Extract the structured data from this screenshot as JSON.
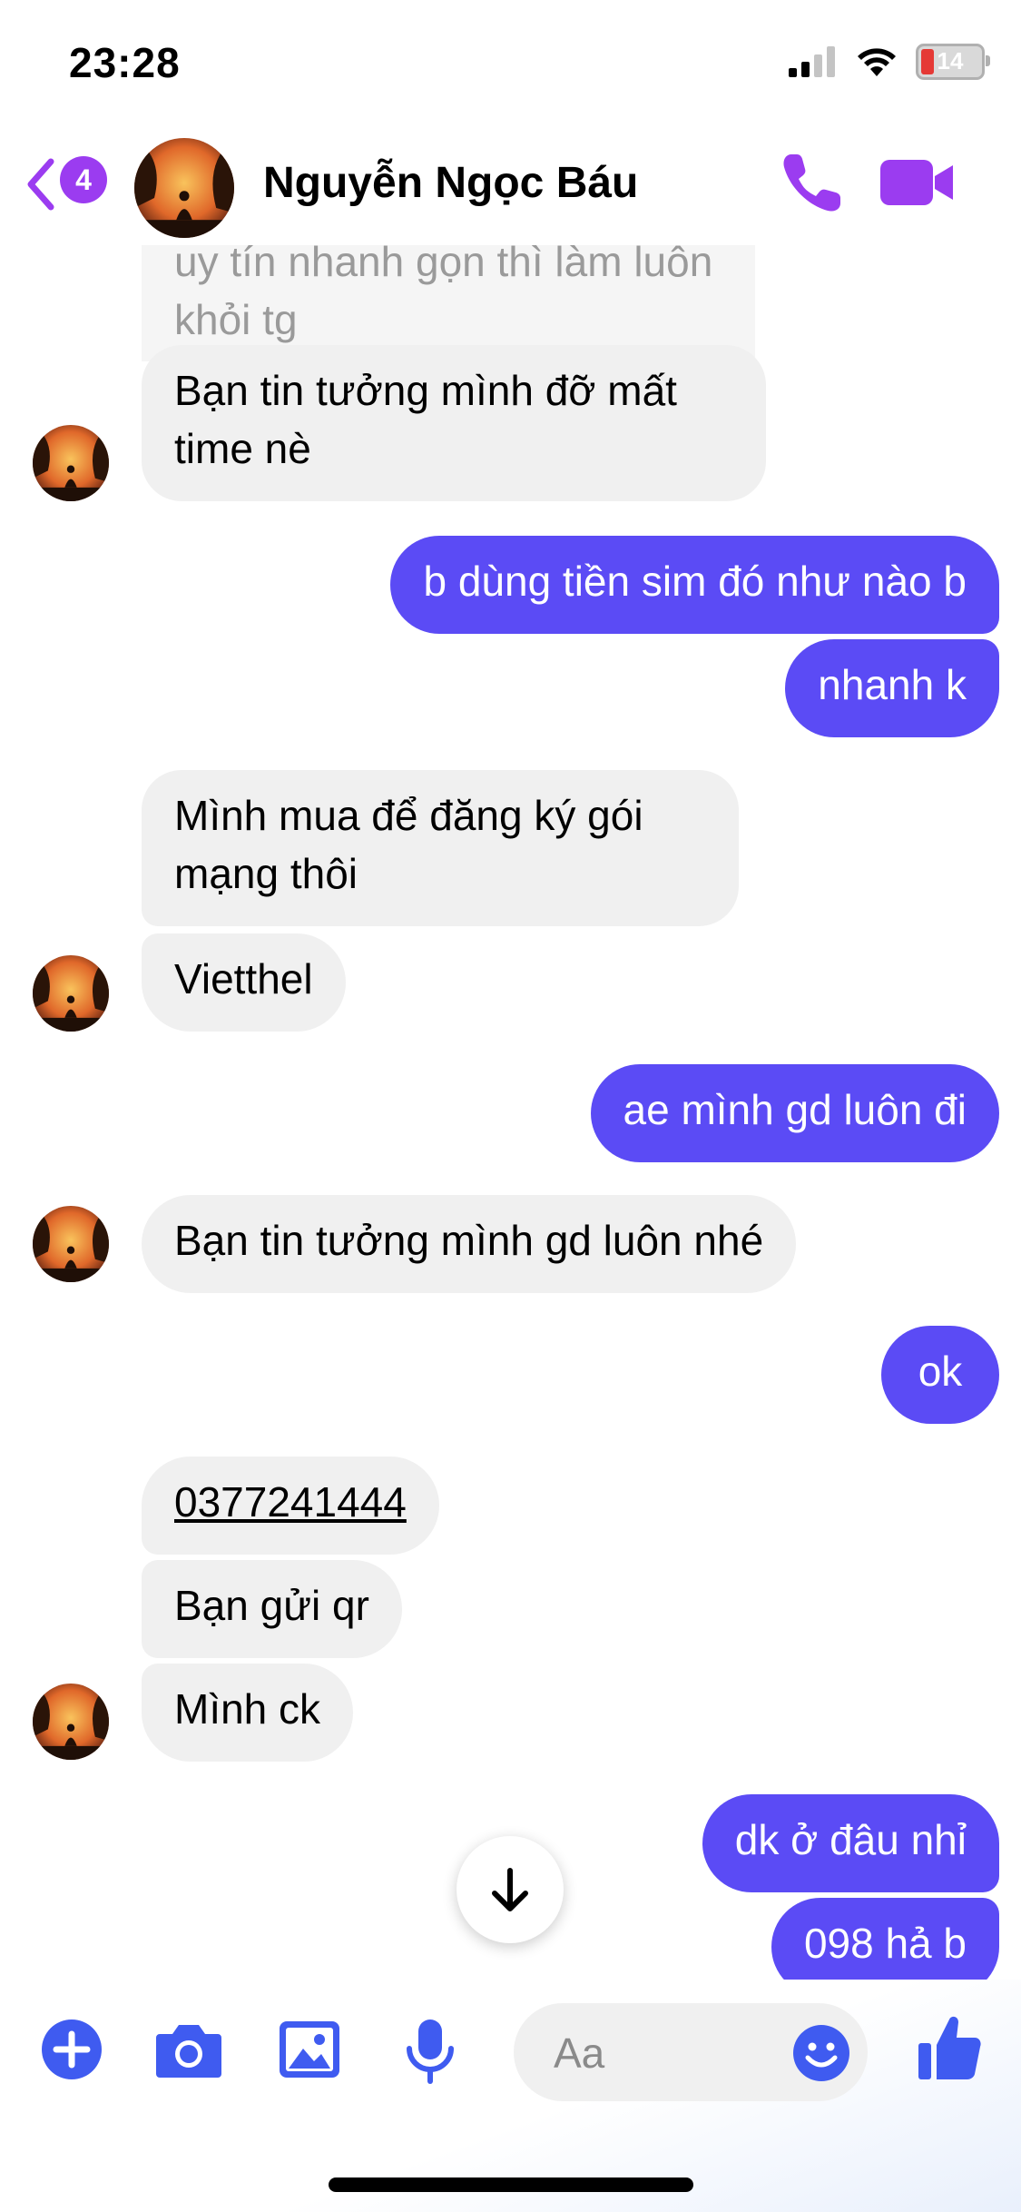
{
  "status_bar": {
    "time": "23:28",
    "battery": "14"
  },
  "header": {
    "back_badge": "4",
    "contact_name": "Nguyễn Ngọc Báu"
  },
  "messages": [
    {
      "side": "in",
      "line1": "uy tín nhanh gọn thì làm luôn",
      "line2": "khỏi tg"
    },
    {
      "side": "in",
      "line1": "Bạn tin tưởng mình đỡ mất",
      "line2": "time nè"
    },
    {
      "side": "out",
      "text": "b dùng tiền sim đó như nào b"
    },
    {
      "side": "out",
      "text": "nhanh k"
    },
    {
      "side": "in",
      "line1": "Mình mua để đăng ký gói",
      "line2": "mạng thôi"
    },
    {
      "side": "in",
      "text": "Vietthel"
    },
    {
      "side": "out",
      "text": "ae mình gd luôn đi"
    },
    {
      "side": "in",
      "text": "Bạn tin tưởng mình gd luôn nhé"
    },
    {
      "side": "out",
      "text": "ok"
    },
    {
      "side": "in",
      "text": "0377241444"
    },
    {
      "side": "in",
      "text": "Bạn gửi qr"
    },
    {
      "side": "in",
      "text": "Mình ck"
    },
    {
      "side": "out",
      "text": "dk ở đâu nhỉ"
    },
    {
      "side": "out",
      "text": "098 hả b"
    }
  ],
  "composer": {
    "placeholder": "Aa"
  },
  "colors": {
    "accent": "#9b3cf0",
    "outgoing_bubble": "#5b4bf5",
    "incoming_bubble": "#f0f0f0",
    "composer_icons": "#3f5bf0"
  },
  "icons": [
    "back-chevron-icon",
    "phone-icon",
    "video-camera-icon",
    "scroll-down-arrow-icon",
    "plus-icon",
    "camera-icon",
    "gallery-icon",
    "microphone-icon",
    "emoji-icon",
    "thumbs-up-icon"
  ]
}
